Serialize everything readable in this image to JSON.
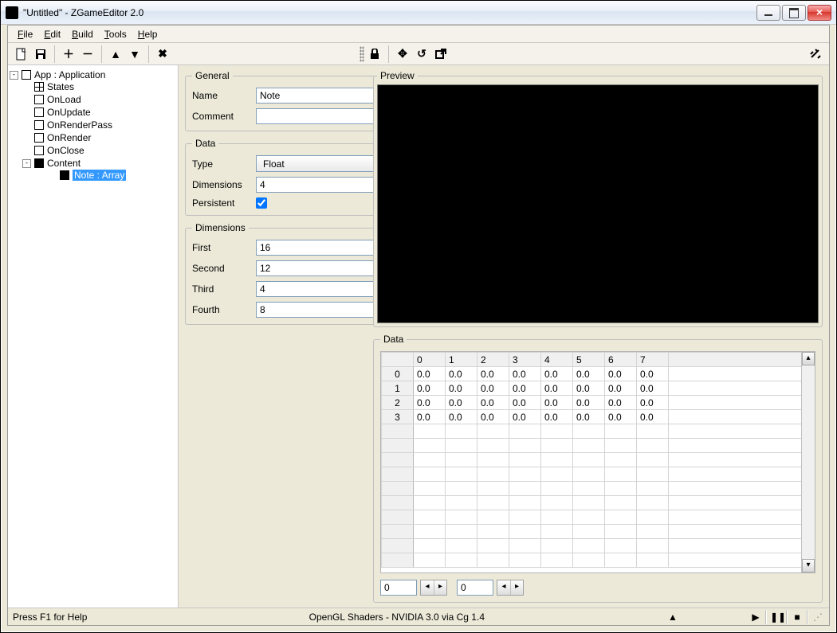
{
  "window": {
    "title": "\"Untitled\" - ZGameEditor 2.0"
  },
  "menu": {
    "file": "File",
    "edit": "Edit",
    "build": "Build",
    "tools": "Tools",
    "help": "Help"
  },
  "tree": {
    "root": "App : Application",
    "states": "States",
    "onload": "OnLoad",
    "onupdate": "OnUpdate",
    "onrenderpass": "OnRenderPass",
    "onrender": "OnRender",
    "onclose": "OnClose",
    "content": "Content",
    "note": "Note : Array"
  },
  "props": {
    "general": {
      "legend": "General",
      "name_label": "Name",
      "name_value": "Note",
      "comment_label": "Comment",
      "comment_value": ""
    },
    "data": {
      "legend": "Data",
      "type_label": "Type",
      "type_value": "Float",
      "dim_label": "Dimensions",
      "dim_value": "4",
      "persist_label": "Persistent",
      "persist_checked": true
    },
    "dims": {
      "legend": "Dimensions",
      "first_label": "First",
      "first_value": "16",
      "second_label": "Second",
      "second_value": "12",
      "third_label": "Third",
      "third_value": "4",
      "fourth_label": "Fourth",
      "fourth_value": "8"
    }
  },
  "preview": {
    "legend": "Preview"
  },
  "datagrid": {
    "legend": "Data",
    "col_headers": [
      "0",
      "1",
      "2",
      "3",
      "4",
      "5",
      "6",
      "7"
    ],
    "row_headers": [
      "0",
      "1",
      "2",
      "3"
    ],
    "cells": [
      [
        "0.0",
        "0.0",
        "0.0",
        "0.0",
        "0.0",
        "0.0",
        "0.0",
        "0.0"
      ],
      [
        "0.0",
        "0.0",
        "0.0",
        "0.0",
        "0.0",
        "0.0",
        "0.0",
        "0.0"
      ],
      [
        "0.0",
        "0.0",
        "0.0",
        "0.0",
        "0.0",
        "0.0",
        "0.0",
        "0.0"
      ],
      [
        "0.0",
        "0.0",
        "0.0",
        "0.0",
        "0.0",
        "0.0",
        "0.0",
        "0.0"
      ]
    ],
    "spin1": "0",
    "spin2": "0"
  },
  "status": {
    "help": "Press F1 for Help",
    "gl": "OpenGL Shaders - NVIDIA 3.0 via Cg 1.4"
  }
}
